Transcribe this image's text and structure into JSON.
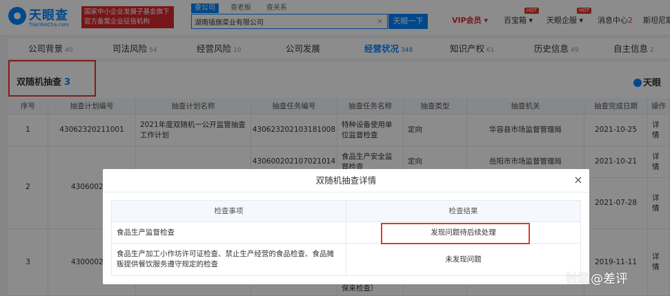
{
  "header": {
    "logo_text": "天眼查",
    "logo_sub": "TianYanCha.com",
    "banner_line1": "国家中小企业发展子基金旗下",
    "banner_line2": "官方备案企业征信机构",
    "search_tabs": [
      "查公司",
      "查老板",
      "查关系"
    ],
    "search_value": "湖南插旗菜业有限公司",
    "search_clear": "×",
    "search_button": "天眼一下",
    "nav": {
      "vip": "VIP会员 ▾",
      "treasure": "百宝箱 ▾",
      "enterprise": "天眼企服 ▾",
      "messages": "消息中心",
      "messages_count": "2",
      "user": "斯坦尼斯",
      "hot": "HOT"
    }
  },
  "page_tabs": [
    {
      "label": "公司背景",
      "count": "40"
    },
    {
      "label": "司法风险",
      "count": "54"
    },
    {
      "label": "经营风险",
      "count": "10"
    },
    {
      "label": "公司发展",
      "count": ""
    },
    {
      "label": "经营状况",
      "count": "348"
    },
    {
      "label": "知识产权",
      "count": "61"
    },
    {
      "label": "历史信息",
      "count": "49"
    },
    {
      "label": "自主信息",
      "count": "2"
    }
  ],
  "section": {
    "title": "双随机抽查",
    "count": "3",
    "logo": "天眼"
  },
  "table": {
    "headers": [
      "序号",
      "抽查计划编号",
      "抽查计划名称",
      "抽查任务编号",
      "抽查任务名称",
      "抽查类型",
      "抽查机关",
      "抽查完成日期",
      "操作"
    ],
    "rows": [
      {
        "no": "1",
        "plan_no": "43062320211001",
        "plan_name": "2021年度双随机一公开监管抽查工作计划",
        "task_no": "430623202103181008",
        "task_name": "特种设备使用单位监督检查",
        "type": "定向",
        "org": "华容县市场监督管理局",
        "date": "2021-10-25",
        "action": "详情"
      },
      {
        "no": "2",
        "plan_no": "430600202",
        "plan_name": "",
        "task_no": "430600202107021014",
        "task_name": "食品生产安全监督检查",
        "type": "定向",
        "org": "岳阳市市场监督管理局",
        "date": "2021-10-21",
        "action": "详情"
      },
      {
        "no": "",
        "plan_no": "",
        "plan_name": "",
        "task_no": "",
        "task_name": "",
        "type": "",
        "org": "",
        "date": "2021-07-28",
        "action": "详情"
      },
      {
        "no": "3",
        "plan_no": "430000201",
        "plan_name": "",
        "task_no": "",
        "task_name": "",
        "type": "",
        "org": "",
        "date": "2019-11-11",
        "action": "详情"
      }
    ],
    "partial_text": "保来检查）"
  },
  "modal": {
    "title": "双随机抽查详情",
    "close": "×",
    "headers": [
      "检查事项",
      "检查结果"
    ],
    "rows": [
      {
        "item": "食品生产监督检查",
        "result": "发现问题待后续处理"
      },
      {
        "item": "食品生产加工小作坊许可证检查、禁止生产经营的食品检查、食品摊贩提供餐饮服务遵守规定的检查",
        "result": "未发现问题"
      }
    ]
  },
  "watermark": "社区@差评"
}
